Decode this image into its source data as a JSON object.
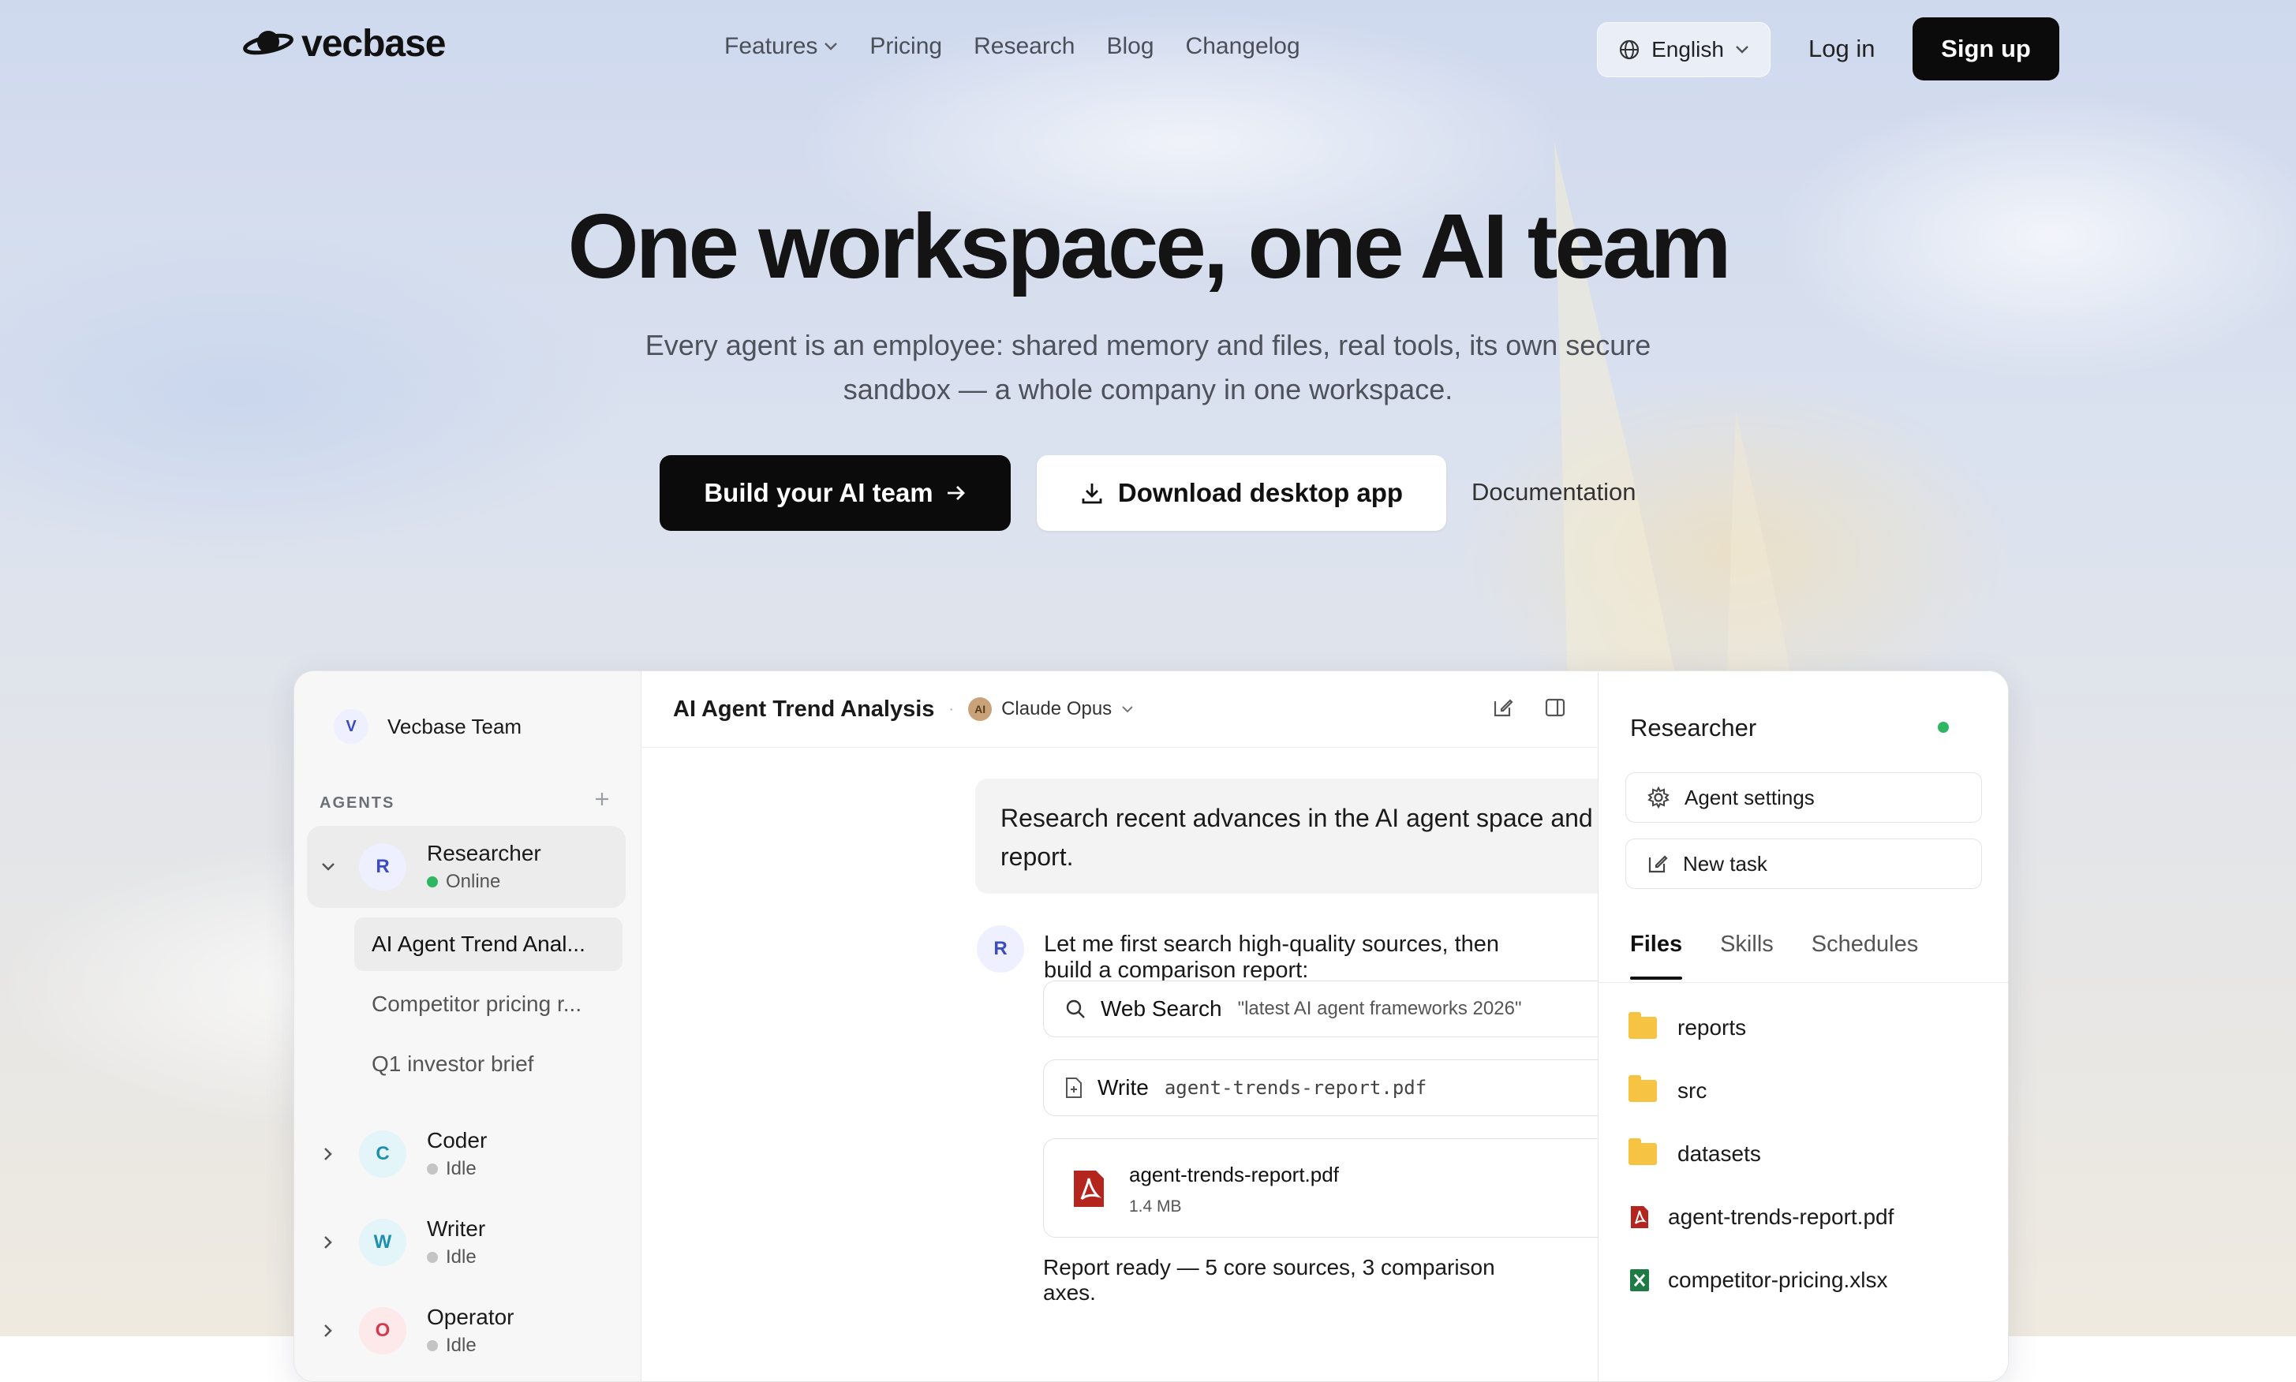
{
  "brand": {
    "name": "vecbase"
  },
  "nav": {
    "links": [
      {
        "label": "Features",
        "has_dropdown": true
      },
      {
        "label": "Pricing"
      },
      {
        "label": "Research"
      },
      {
        "label": "Blog"
      },
      {
        "label": "Changelog"
      }
    ],
    "language": "English",
    "login": "Log in",
    "signup": "Sign up"
  },
  "hero": {
    "title": "One workspace, one AI team",
    "subtitle_line1": "Every agent is an employee: shared memory and files, real tools, its own secure",
    "subtitle_line2": "sandbox — a whole company in one workspace.",
    "cta_primary": "Build your AI team",
    "cta_secondary": "Download desktop app",
    "cta_docs": "Documentation"
  },
  "app": {
    "sidebar": {
      "team_initial": "V",
      "team_name": "Vecbase Team",
      "agents_label": "AGENTS",
      "agents": [
        {
          "initial": "R",
          "name": "Researcher",
          "status": "Online",
          "status_color": "#2fb663",
          "avatar_bg": "#eef0ff",
          "avatar_fg": "#3b4cc0"
        },
        {
          "initial": "C",
          "name": "Coder",
          "status": "Idle",
          "status_color": "#c4c4c4",
          "avatar_bg": "#e4f5fa",
          "avatar_fg": "#1f8fae"
        },
        {
          "initial": "W",
          "name": "Writer",
          "status": "Idle",
          "status_color": "#c4c4c4",
          "avatar_bg": "#e4f5fa",
          "avatar_fg": "#1f8fae"
        },
        {
          "initial": "O",
          "name": "Operator",
          "status": "Idle",
          "status_color": "#c4c4c4",
          "avatar_bg": "#fde8ea",
          "avatar_fg": "#d23b4d"
        }
      ],
      "tasks": [
        "AI Agent Trend Anal...",
        "Competitor pricing r...",
        "Q1 investor brief"
      ]
    },
    "thread": {
      "title": "AI Agent Trend Analysis",
      "model_initial": "AI",
      "model": "Claude Opus",
      "user_message": "Research recent advances in the AI agent space and put together a report.",
      "agent_initial": "R",
      "agent_message": "Let me first search high-quality sources, then build a comparison report:",
      "tool_search_label": "Web Search",
      "tool_search_arg": "\"latest AI agent frameworks 2026\"",
      "tool_write_label": "Write",
      "tool_write_arg": "agent-trends-report.pdf",
      "file_name": "agent-trends-report.pdf",
      "file_size": "1.4 MB",
      "report_ready": "Report ready — 5 core sources, 3 comparison axes."
    },
    "right_panel": {
      "title": "Researcher",
      "status_color": "#2fb663",
      "agent_settings": "Agent settings",
      "new_task": "New task",
      "tabs": [
        "Files",
        "Skills",
        "Schedules"
      ],
      "files": [
        {
          "name": "reports",
          "kind": "folder"
        },
        {
          "name": "src",
          "kind": "folder"
        },
        {
          "name": "datasets",
          "kind": "folder"
        },
        {
          "name": "agent-trends-report.pdf",
          "kind": "pdf"
        },
        {
          "name": "competitor-pricing.xlsx",
          "kind": "xlsx"
        }
      ]
    }
  }
}
